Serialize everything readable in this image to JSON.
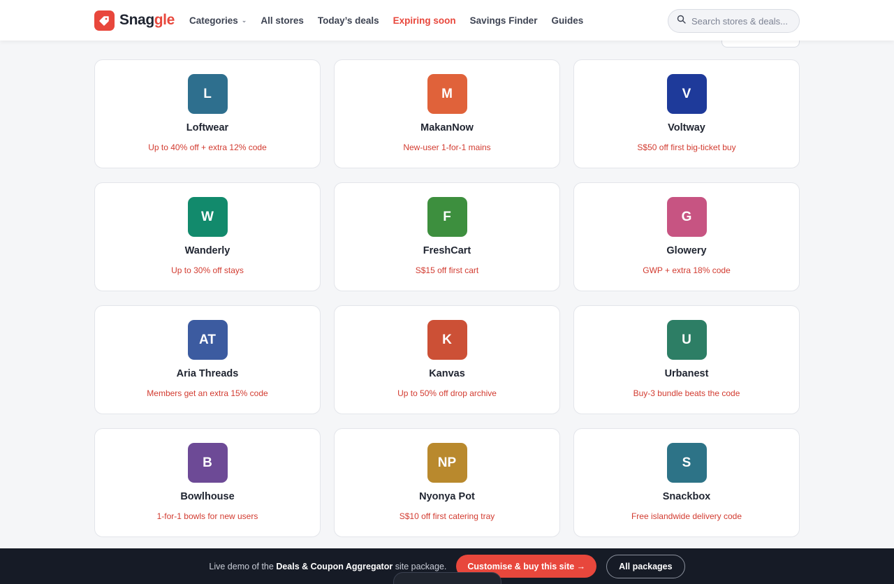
{
  "brand": {
    "name_main": "Snag",
    "name_accent": "gle",
    "accent_color": "#e8473c"
  },
  "nav": [
    {
      "label": "Categories",
      "has_dropdown": true,
      "hot": false
    },
    {
      "label": "All stores",
      "has_dropdown": false,
      "hot": false
    },
    {
      "label": "Today’s deals",
      "has_dropdown": false,
      "hot": false
    },
    {
      "label": "Expiring soon",
      "has_dropdown": false,
      "hot": true
    },
    {
      "label": "Savings Finder",
      "has_dropdown": false,
      "hot": false
    },
    {
      "label": "Guides",
      "has_dropdown": false,
      "hot": false
    }
  ],
  "search": {
    "placeholder": "Search stores & deals..."
  },
  "stores": [
    {
      "initials": "L",
      "name": "Loftwear",
      "deal": "Up to 40% off + extra 12% code",
      "color": "#2e6f8e"
    },
    {
      "initials": "M",
      "name": "MakanNow",
      "deal": "New-user 1-for-1 mains",
      "color": "#e0623a"
    },
    {
      "initials": "V",
      "name": "Voltway",
      "deal": "S$50 off first big-ticket buy",
      "color": "#1e3a9a"
    },
    {
      "initials": "W",
      "name": "Wanderly",
      "deal": "Up to 30% off stays",
      "color": "#128a6c"
    },
    {
      "initials": "F",
      "name": "FreshCart",
      "deal": "S$15 off first cart",
      "color": "#3d8f3e"
    },
    {
      "initials": "G",
      "name": "Glowery",
      "deal": "GWP + extra 18% code",
      "color": "#c75482"
    },
    {
      "initials": "AT",
      "name": "Aria Threads",
      "deal": "Members get an extra 15% code",
      "color": "#3c5ba0"
    },
    {
      "initials": "K",
      "name": "Kanvas",
      "deal": "Up to 50% off drop archive",
      "color": "#cc5036"
    },
    {
      "initials": "U",
      "name": "Urbanest",
      "deal": "Buy-3 bundle beats the code",
      "color": "#2d7e65"
    },
    {
      "initials": "B",
      "name": "Bowlhouse",
      "deal": "1-for-1 bowls for new users",
      "color": "#6d4a96"
    },
    {
      "initials": "NP",
      "name": "Nyonya Pot",
      "deal": "S$10 off first catering tray",
      "color": "#b9892d"
    },
    {
      "initials": "S",
      "name": "Snackbox",
      "deal": "Free islandwide delivery code",
      "color": "#2d7387"
    }
  ],
  "promo": {
    "prefix": "Live demo of the ",
    "package": "Deals & Coupon Aggregator",
    "suffix": " site package.",
    "cta": "Customise & buy this site →",
    "secondary": "All packages"
  }
}
